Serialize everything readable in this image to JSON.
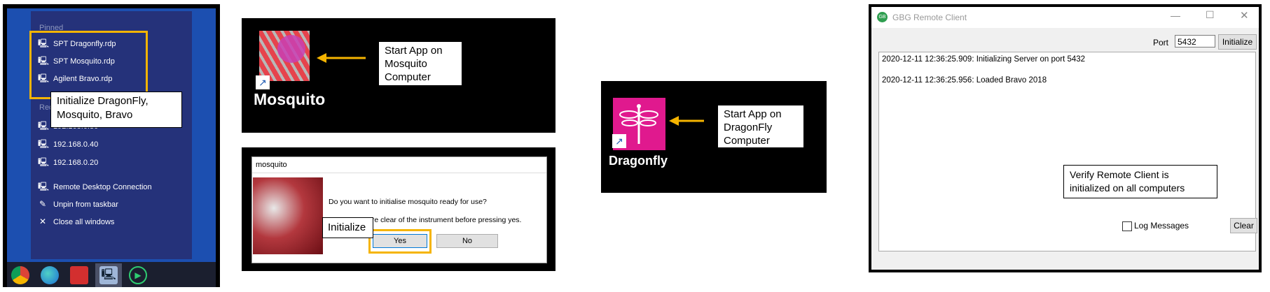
{
  "jump_list": {
    "pinned_header": "Pinned",
    "pinned_items": [
      "SPT Dragonfly.rdp",
      "SPT Mosquito.rdp",
      "Agilent Bravo.rdp"
    ],
    "recent_header": "Recent",
    "recent_items": [
      "192.168.0.30",
      "192.168.0.40",
      "192.168.0.20"
    ],
    "actions": [
      "Remote Desktop Connection",
      "Unpin from taskbar",
      "Close all windows"
    ],
    "callout": "Initialize DragonFly, Mosquito, Bravo",
    "taskbar_icons": [
      "chrome-icon",
      "edge-icon",
      "red-app-icon",
      "remote-desktop-icon",
      "media-icon"
    ]
  },
  "mosquito_icon": {
    "label": "Mosquito",
    "callout": "Start App on Mosquito Computer"
  },
  "mosquito_dialog": {
    "title": "mosquito",
    "question": "Do you want to initialise mosquito ready for use?",
    "warning": "Ensure you are clear of the instrument before pressing yes.",
    "yes_label": "Yes",
    "no_label": "No",
    "callout": "Initialize"
  },
  "dragonfly_icon": {
    "label": "Dragonfly",
    "callout": "Start App on DragonFly Computer"
  },
  "remote_client": {
    "title": "GBG Remote Client",
    "port_label": "Port",
    "port_value": "5432",
    "initialize_label": "Initialize",
    "log_lines": [
      "2020-12-11 12:36:25.909: Initializing Server on port 5432",
      "2020-12-11 12:36:25.956: Loaded Bravo 2018"
    ],
    "log_messages_label": "Log Messages",
    "clear_label": "Clear",
    "callout": "Verify Remote Client is initialized on all computers"
  },
  "colors": {
    "highlight": "#f5b400",
    "dragonfly_pink": "#e0198e",
    "mosquito_red": "#d8323a"
  }
}
